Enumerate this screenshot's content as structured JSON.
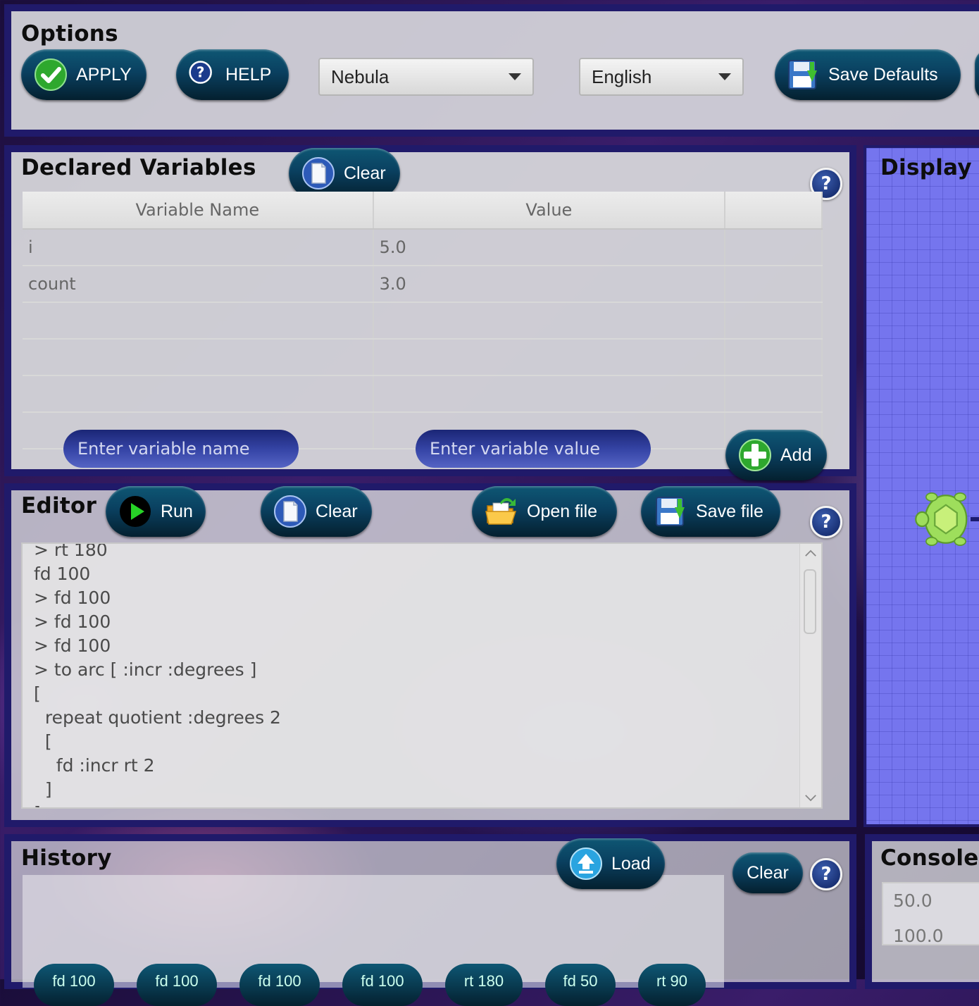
{
  "options": {
    "title": "Options",
    "apply_label": "APPLY",
    "help_label": "HELP",
    "theme_selected": "Nebula",
    "language_selected": "English",
    "save_defaults_label": "Save Defaults"
  },
  "variables": {
    "title": "Declared Variables",
    "clear_label": "Clear",
    "help_glyph": "?",
    "columns": [
      "Variable Name",
      "Value"
    ],
    "rows": [
      {
        "name": "i",
        "value": "5.0"
      },
      {
        "name": "count",
        "value": "3.0"
      }
    ],
    "name_placeholder": "Enter variable name",
    "value_placeholder": "Enter variable value",
    "add_label": "Add"
  },
  "editor": {
    "title": "Editor",
    "run_label": "Run",
    "clear_label": "Clear",
    "open_label": "Open file",
    "save_label": "Save file",
    "help_glyph": "?",
    "lines": [
      "> rt 180",
      "fd 100",
      "> fd 100",
      "> fd 100",
      "> fd 100",
      "> to arc [ :incr :degrees ]",
      "[",
      "  repeat quotient :degrees 2",
      "  [",
      "    fd :incr rt 2",
      "  ]",
      "]"
    ]
  },
  "display": {
    "title": "Display",
    "turtle_icon": "turtle-icon"
  },
  "history": {
    "title": "History",
    "load_label": "Load",
    "clear_label": "Clear",
    "help_glyph": "?",
    "chips": [
      "fd 100",
      "fd 100",
      "fd 100",
      "fd 100",
      "rt 180",
      "fd 50",
      "rt 90"
    ]
  },
  "console": {
    "title": "Console",
    "lines": [
      "50.0",
      "100.0"
    ]
  },
  "colors": {
    "accent": "#0a4060",
    "border": "#201a6a",
    "display_bg": "#6e6ef0"
  }
}
